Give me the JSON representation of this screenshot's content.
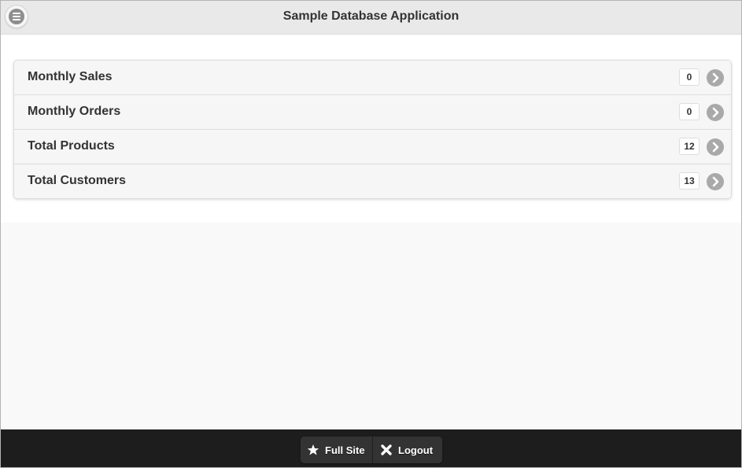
{
  "header": {
    "title": "Sample Database Application",
    "menu_icon": "menu-icon"
  },
  "list": {
    "items": [
      {
        "label": "Monthly Sales",
        "count": "0"
      },
      {
        "label": "Monthly Orders",
        "count": "0"
      },
      {
        "label": "Total Products",
        "count": "12"
      },
      {
        "label": "Total Customers",
        "count": "13"
      }
    ],
    "arrow_icon": "chevron-right-icon"
  },
  "footer": {
    "full_site_label": "Full Site",
    "full_site_icon": "star-icon",
    "logout_label": "Logout",
    "logout_icon": "close-icon"
  },
  "colors": {
    "header_bg": "#e9e9e9",
    "footer_bg": "#1d1d1d",
    "item_bg": "#f6f6f6",
    "text": "#333333",
    "arrow": "#a9a9a9"
  }
}
